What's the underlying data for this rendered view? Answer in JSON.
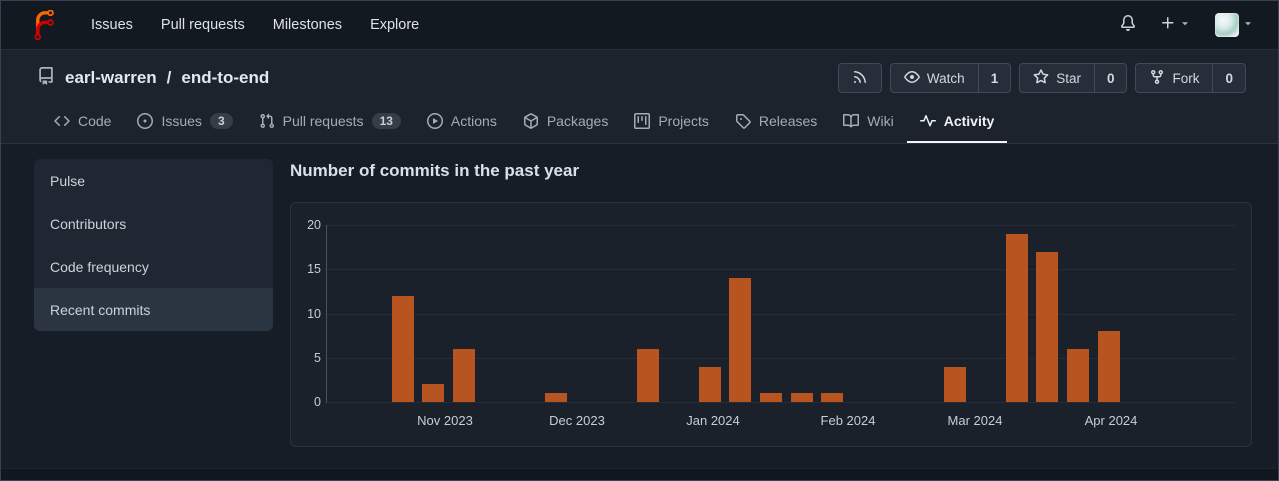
{
  "navbar": {
    "links": [
      {
        "id": "issues",
        "label": "Issues"
      },
      {
        "id": "pull-requests",
        "label": "Pull requests"
      },
      {
        "id": "milestones",
        "label": "Milestones"
      },
      {
        "id": "explore",
        "label": "Explore"
      }
    ],
    "icons": [
      "forgejo-logo",
      "bell-icon",
      "plus-icon",
      "caret-down-icon",
      "avatar"
    ]
  },
  "repo": {
    "owner": "earl-warren",
    "separator": "/",
    "name": "end-to-end",
    "buttons": [
      {
        "id": "rss",
        "icon": "rss-icon"
      },
      {
        "id": "watch",
        "icon": "eye-icon",
        "label": "Watch",
        "count": "1"
      },
      {
        "id": "star",
        "icon": "star-icon",
        "label": "Star",
        "count": "0"
      },
      {
        "id": "fork",
        "icon": "fork-icon",
        "label": "Fork",
        "count": "0"
      }
    ]
  },
  "tabs": [
    {
      "id": "code",
      "icon": "code-icon",
      "label": "Code"
    },
    {
      "id": "issues",
      "icon": "issue-opened-icon",
      "label": "Issues",
      "badge": "3"
    },
    {
      "id": "pull-requests",
      "icon": "git-pull-request-icon",
      "label": "Pull requests",
      "badge": "13"
    },
    {
      "id": "actions",
      "icon": "play-icon",
      "label": "Actions"
    },
    {
      "id": "packages",
      "icon": "package-icon",
      "label": "Packages"
    },
    {
      "id": "projects",
      "icon": "project-icon",
      "label": "Projects"
    },
    {
      "id": "releases",
      "icon": "tag-icon",
      "label": "Releases"
    },
    {
      "id": "wiki",
      "icon": "book-icon",
      "label": "Wiki"
    },
    {
      "id": "activity",
      "icon": "pulse-icon",
      "label": "Activity",
      "active": true
    }
  ],
  "sidebar": {
    "items": [
      {
        "id": "pulse",
        "label": "Pulse"
      },
      {
        "id": "contributors",
        "label": "Contributors"
      },
      {
        "id": "code-frequency",
        "label": "Code frequency"
      },
      {
        "id": "recent-commits",
        "label": "Recent commits",
        "active": true
      }
    ]
  },
  "chart_data": {
    "type": "bar",
    "title": "Number of commits in the past year",
    "xlabel": "",
    "ylabel": "",
    "ylim": [
      0,
      20
    ],
    "yticks": [
      20,
      15,
      10,
      5,
      0
    ],
    "x_unit": "week",
    "x_tick_labels": [
      "Nov 2023",
      "Dec 2023",
      "Jan 2024",
      "Feb 2024",
      "Mar 2024",
      "Apr 2024"
    ],
    "series": [
      {
        "name": "commits",
        "values": [
          12,
          2,
          6,
          0,
          0,
          1,
          0,
          0,
          6,
          0,
          4,
          14,
          1,
          1,
          1,
          0,
          0,
          0,
          4,
          0,
          19,
          17,
          6,
          8
        ]
      }
    ],
    "bar_color": "#b8541f",
    "grid": true,
    "legend_position": "none"
  }
}
